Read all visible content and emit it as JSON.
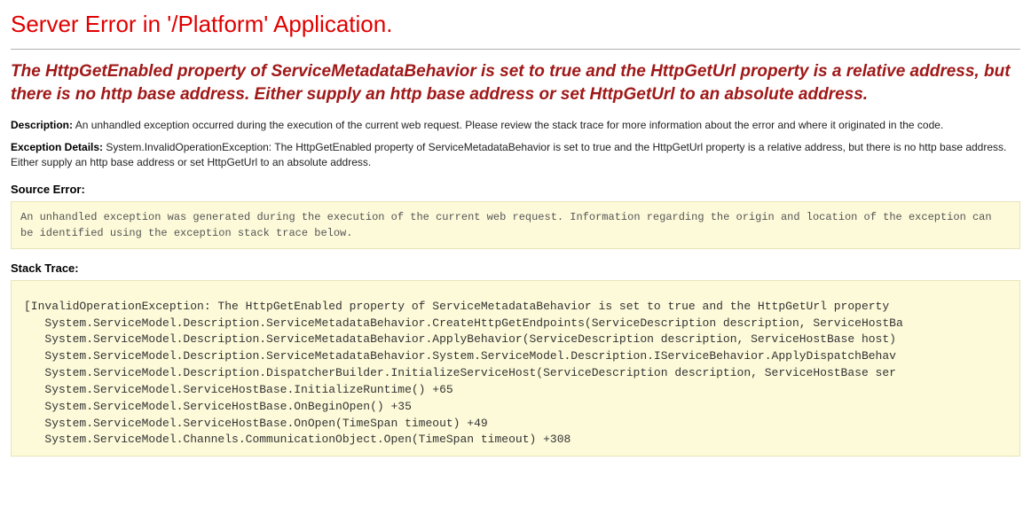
{
  "header": {
    "title": "Server Error in '/Platform' Application."
  },
  "error": {
    "message": "The HttpGetEnabled property of ServiceMetadataBehavior is set to true and the HttpGetUrl property is a relative address, but there is no http base address.  Either supply an http base address or set HttpGetUrl to an absolute address."
  },
  "description": {
    "label": "Description:",
    "text": "An unhandled exception occurred during the execution of the current web request. Please review the stack trace for more information about the error and where it originated in the code."
  },
  "exception_details": {
    "label": "Exception Details:",
    "text": "System.InvalidOperationException: The HttpGetEnabled property of ServiceMetadataBehavior is set to true and the HttpGetUrl property is a relative address, but there is no http base address.  Either supply an http base address or set HttpGetUrl to an absolute address."
  },
  "source_error": {
    "label": "Source Error:",
    "text": "An unhandled exception was generated during the execution of the current web request. Information regarding the origin and location of the exception can be identified using the exception stack trace below."
  },
  "stack_trace": {
    "label": "Stack Trace:",
    "text": "[InvalidOperationException: The HttpGetEnabled property of ServiceMetadataBehavior is set to true and the HttpGetUrl property \n   System.ServiceModel.Description.ServiceMetadataBehavior.CreateHttpGetEndpoints(ServiceDescription description, ServiceHostBa\n   System.ServiceModel.Description.ServiceMetadataBehavior.ApplyBehavior(ServiceDescription description, ServiceHostBase host)\n   System.ServiceModel.Description.ServiceMetadataBehavior.System.ServiceModel.Description.IServiceBehavior.ApplyDispatchBehav\n   System.ServiceModel.Description.DispatcherBuilder.InitializeServiceHost(ServiceDescription description, ServiceHostBase ser\n   System.ServiceModel.ServiceHostBase.InitializeRuntime() +65\n   System.ServiceModel.ServiceHostBase.OnBeginOpen() +35\n   System.ServiceModel.ServiceHostBase.OnOpen(TimeSpan timeout) +49\n   System.ServiceModel.Channels.CommunicationObject.Open(TimeSpan timeout) +308"
  }
}
